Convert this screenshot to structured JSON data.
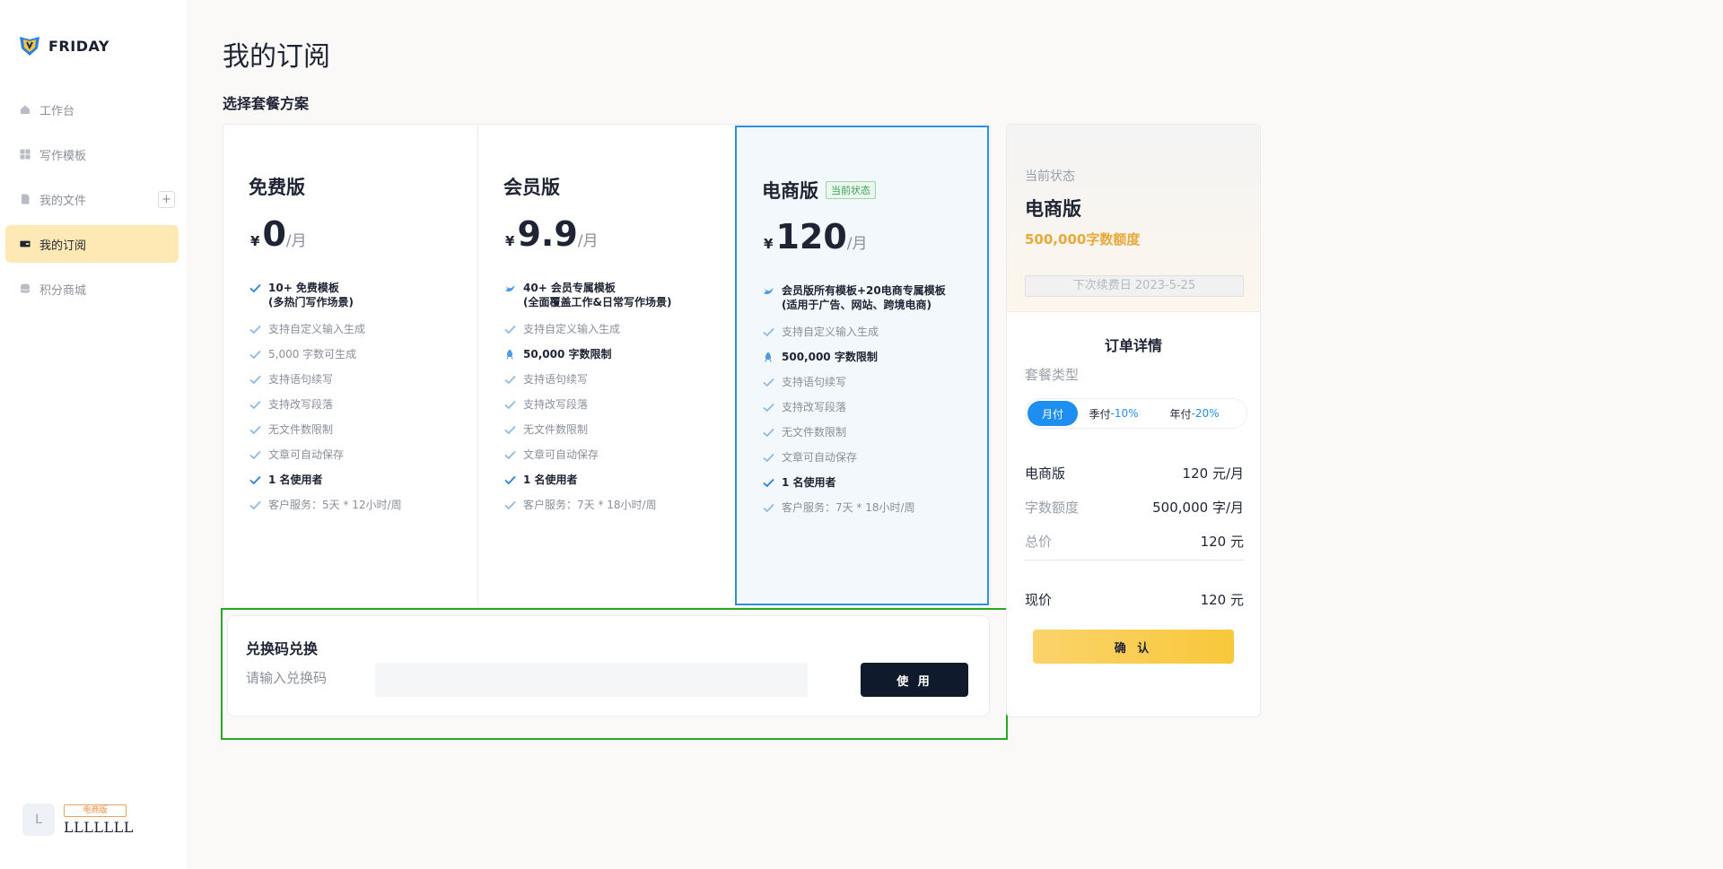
{
  "app": {
    "name": "FRIDAY"
  },
  "sidebar": {
    "items": [
      {
        "label": "工作台",
        "icon": "home-icon"
      },
      {
        "label": "写作模板",
        "icon": "grid-icon"
      },
      {
        "label": "我的文件",
        "icon": "file-icon",
        "action": "+"
      },
      {
        "label": "我的订阅",
        "icon": "card-icon",
        "active": true
      },
      {
        "label": "积分商城",
        "icon": "database-icon"
      }
    ]
  },
  "user": {
    "avatar_letter": "L",
    "badge": "电商版",
    "name": "LLLLLLL"
  },
  "page": {
    "title": "我的订阅",
    "section": "选择套餐方案"
  },
  "plans": [
    {
      "name": "免费版",
      "currency": "¥",
      "price": "0",
      "unit": "/月",
      "features": [
        {
          "text": "10+ 免费模板",
          "sub": "(多热门写作场景)",
          "icon": "check-icon",
          "strong": true
        },
        {
          "text": "支持自定义输入生成",
          "icon": "check-icon"
        },
        {
          "text": "5,000 字数可生成",
          "icon": "check-icon"
        },
        {
          "text": "支持语句续写",
          "icon": "check-icon"
        },
        {
          "text": "支持改写段落",
          "icon": "check-icon"
        },
        {
          "text": "无文件数限制",
          "icon": "check-icon"
        },
        {
          "text": "文章可自动保存",
          "icon": "check-icon"
        },
        {
          "text": "1 名使用者",
          "icon": "check-icon",
          "strong": true
        },
        {
          "text": "客户服务：5天 * 12小时/周",
          "icon": "check-icon"
        }
      ]
    },
    {
      "name": "会员版",
      "currency": "¥",
      "price": "9.9",
      "unit": "/月",
      "features": [
        {
          "text": "40+ 会员专属模板",
          "sub": "(全面覆盖工作&日常写作场景)",
          "icon": "bird-icon",
          "strong": true
        },
        {
          "text": "支持自定义输入生成",
          "icon": "check-icon"
        },
        {
          "text": "50,000 字数限制",
          "icon": "rocket-icon",
          "strong": true
        },
        {
          "text": "支持语句续写",
          "icon": "check-icon"
        },
        {
          "text": "支持改写段落",
          "icon": "check-icon"
        },
        {
          "text": "无文件数限制",
          "icon": "check-icon"
        },
        {
          "text": "文章可自动保存",
          "icon": "check-icon"
        },
        {
          "text": "1 名使用者",
          "icon": "check-icon",
          "strong": true
        },
        {
          "text": "客户服务：7天 * 18小时/周",
          "icon": "check-icon"
        }
      ]
    },
    {
      "name": "电商版",
      "tag": "当前状态",
      "currency": "¥",
      "price": "120",
      "unit": "/月",
      "features": [
        {
          "text": "会员版所有模板+20电商专属模板",
          "sub": "(适用于广告、网站、跨境电商)",
          "icon": "bird-icon",
          "strong": true
        },
        {
          "text": "支持自定义输入生成",
          "icon": "check-icon"
        },
        {
          "text": "500,000 字数限制",
          "icon": "rocket-icon",
          "strong": true
        },
        {
          "text": "支持语句续写",
          "icon": "check-icon"
        },
        {
          "text": "支持改写段落",
          "icon": "check-icon"
        },
        {
          "text": "无文件数限制",
          "icon": "check-icon"
        },
        {
          "text": "文章可自动保存",
          "icon": "check-icon"
        },
        {
          "text": "1 名使用者",
          "icon": "check-icon",
          "strong": true
        },
        {
          "text": "客户服务：7天 * 18小时/周",
          "icon": "check-icon"
        }
      ]
    }
  ],
  "redeem": {
    "title": "兑换码兑换",
    "label": "请输入兑换码",
    "input_value": "",
    "button": "使 用"
  },
  "order": {
    "status_label": "当前状态",
    "status_plan": "电商版",
    "status_quota": "500,000字数额度",
    "renew": "下次续费日 2023-5-25",
    "title": "订单详情",
    "package_type_label": "套餐类型",
    "periods": [
      {
        "label": "月付",
        "discount": "",
        "active": true
      },
      {
        "label": "季付",
        "discount": "-10%"
      },
      {
        "label": "年付",
        "discount": "-20%"
      }
    ],
    "rows": {
      "plan": {
        "k": "电商版",
        "v": "120 元/月"
      },
      "quota": {
        "k": "字数额度",
        "v": "500,000 字/月"
      },
      "total": {
        "k": "总价",
        "v": "120 元"
      },
      "now": {
        "k": "现价",
        "v": "120 元"
      }
    },
    "confirm": "确 认"
  },
  "colors": {
    "accent_blue": "#1e8ef0",
    "active_nav": "#fee9b5",
    "quota_gold": "#e8a83a",
    "highlight_green": "#26a826",
    "dark_button": "#0f1a2b"
  }
}
